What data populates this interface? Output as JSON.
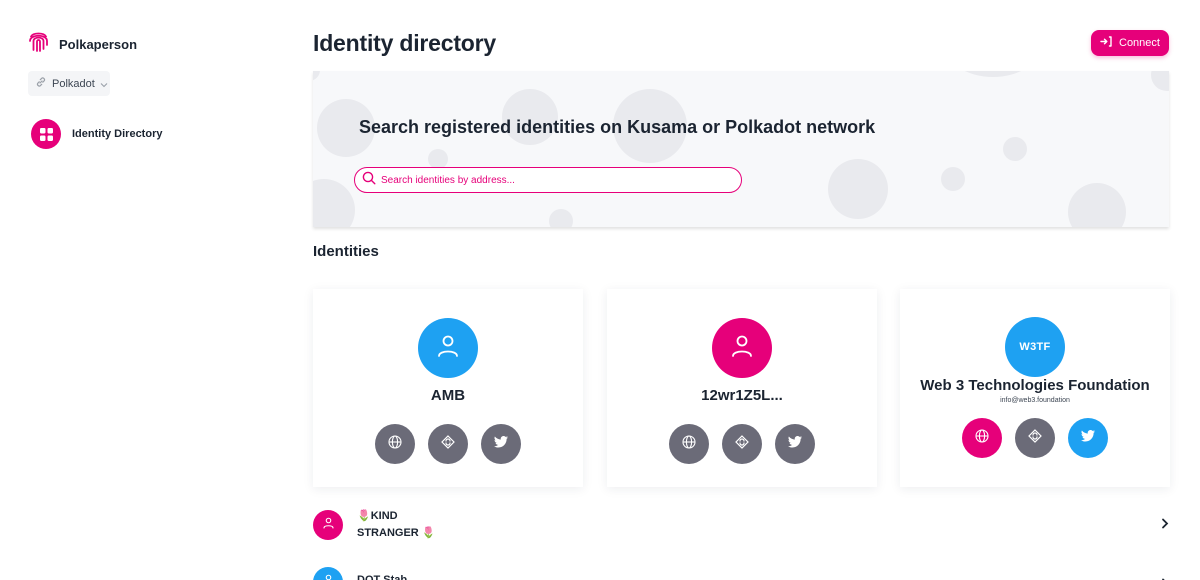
{
  "app": {
    "name": "Polkaperson"
  },
  "network": {
    "selected": "Polkadot"
  },
  "sidebar": {
    "items": [
      {
        "label": "Identity Directory"
      }
    ]
  },
  "header": {
    "title": "Identity directory",
    "connect_label": "Connect"
  },
  "search": {
    "heading": "Search registered identities on Kusama or Polkadot network",
    "placeholder": "Search identities by address..."
  },
  "identities_heading": "Identities",
  "colors": {
    "accent": "#e6007a",
    "blue": "#1ea1f2",
    "gray": "#6b6b78"
  },
  "cards": [
    {
      "name": "AMB",
      "avatar": "person-icon",
      "avatar_color": "#1ea1f2",
      "email": ""
    },
    {
      "name": "12wr1Z5L...",
      "avatar": "person-icon",
      "avatar_color": "#e6007a",
      "email": ""
    },
    {
      "name": "Web 3 Technologies Foundation",
      "avatar_text": "W3TF",
      "avatar_color": "#1ea1f2",
      "email": "info@web3.foundation"
    }
  ],
  "list": [
    {
      "name_line1": "🌷KIND",
      "name_line2": "STRANGER 🌷"
    },
    {
      "name_line1": "DOT Stab"
    }
  ]
}
